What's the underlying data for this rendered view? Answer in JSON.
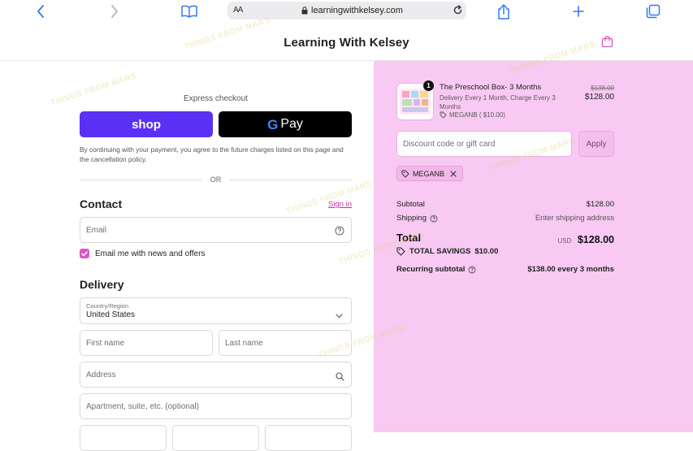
{
  "browser": {
    "reader_label": "AA",
    "url": "learningwithkelsey.com"
  },
  "header": {
    "brand": "Learning With Kelsey"
  },
  "checkout": {
    "express_label": "Express checkout",
    "shop_button": "shop",
    "gpay_button": "Pay",
    "disclaimer": "By continuing with your payment, you agree to the future charges listed on this page and the cancellation policy.",
    "or_label": "OR",
    "contact_title": "Contact",
    "signin_link": "Sign in",
    "email_placeholder": "Email",
    "newsletter_label": "Email me with news and offers",
    "newsletter_checked": true,
    "delivery_title": "Delivery",
    "country_label": "Country/Region",
    "country_value": "United States",
    "first_name_placeholder": "First name",
    "last_name_placeholder": "Last name",
    "address_placeholder": "Address",
    "apartment_placeholder": "Apartment, suite, etc. (optional)"
  },
  "summary": {
    "product": {
      "quantity": "1",
      "title": "The Preschool Box- 3 Months",
      "subtitle": "Delivery Every 1 Month, Charge Every 3 Months",
      "discount_code": "MEGANB ( $10.00)",
      "original_price": "$138.00",
      "price": "$128.00"
    },
    "discount_placeholder": "Discount code or gift card",
    "apply_button": "Apply",
    "applied_code": "MEGANB",
    "subtotal_label": "Subtotal",
    "subtotal_value": "$128.00",
    "shipping_label": "Shipping",
    "shipping_value": "Enter shipping address",
    "total_label": "Total",
    "currency": "USD",
    "total_value": "$128.00",
    "savings_label": "TOTAL SAVINGS",
    "savings_value": "$10.00",
    "recurring_label": "Recurring subtotal",
    "recurring_value": "$138.00 every 3 months"
  },
  "colors": {
    "accent": "#c52ea9",
    "summary_bg": "#f8c9f2",
    "shop_purple": "#5a31f4",
    "checkbox": "#d957c5",
    "safari_blue": "#3478f6"
  },
  "watermark_text": "THINGS FROM MARS"
}
